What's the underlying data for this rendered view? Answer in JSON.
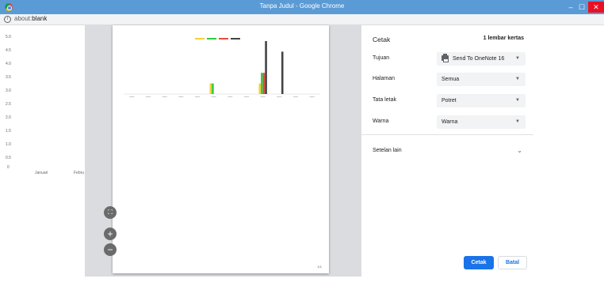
{
  "window": {
    "title": "Tanpa Judul - Google Chrome",
    "min_label": "–",
    "max_label": "☐",
    "close_label": "✕"
  },
  "address_bar": {
    "scheme_host": "about:",
    "path": "blank"
  },
  "background_chart": {
    "y_ticks": [
      "5.0",
      "4.5",
      "4.0",
      "3.5",
      "3.0",
      "2.5",
      "2.0",
      "1.5",
      "1.0",
      "0.5",
      "0"
    ],
    "x_labels": [
      "Januari",
      "Febru"
    ]
  },
  "preview": {
    "page_number": "1/1",
    "zoom_fit_icon": "fit-to-page-icon",
    "zoom_in_icon": "plus-icon",
    "zoom_out_icon": "minus-icon"
  },
  "chart_data": {
    "type": "bar",
    "categories": [
      "1",
      "2",
      "3",
      "4",
      "5",
      "6",
      "7",
      "8",
      "9",
      "10",
      "11",
      "12"
    ],
    "series": [
      {
        "color": "#f4d03f",
        "values": [
          0,
          0,
          0,
          0,
          0,
          1.0,
          0,
          0,
          1.0,
          0,
          0,
          0
        ]
      },
      {
        "color": "#2ecc40",
        "values": [
          0,
          0,
          0,
          0,
          0,
          1.0,
          0,
          0,
          2.0,
          0,
          0,
          0
        ]
      },
      {
        "color": "#e74c3c",
        "values": [
          0,
          0,
          0,
          0,
          0,
          0,
          0,
          0,
          2.0,
          0,
          0,
          0
        ]
      },
      {
        "color": "#444444",
        "values": [
          0,
          0,
          0,
          0,
          0,
          0,
          0,
          0,
          5.0,
          4.0,
          0,
          0
        ]
      }
    ],
    "ylim": [
      0,
      5
    ]
  },
  "dialog": {
    "title": "Cetak",
    "sheets": "1 lembar kertas",
    "destination_label": "Tujuan",
    "destination_value": "Send To OneNote 16",
    "pages_label": "Halaman",
    "pages_value": "Semua",
    "layout_label": "Tata letak",
    "layout_value": "Potret",
    "color_label": "Warna",
    "color_value": "Warna",
    "more_settings": "Setelan lain",
    "print_button": "Cetak",
    "cancel_button": "Batal"
  },
  "colors": {
    "titlebar": "#5b9bd5",
    "accent": "#1a73e8",
    "close": "#e81123"
  }
}
